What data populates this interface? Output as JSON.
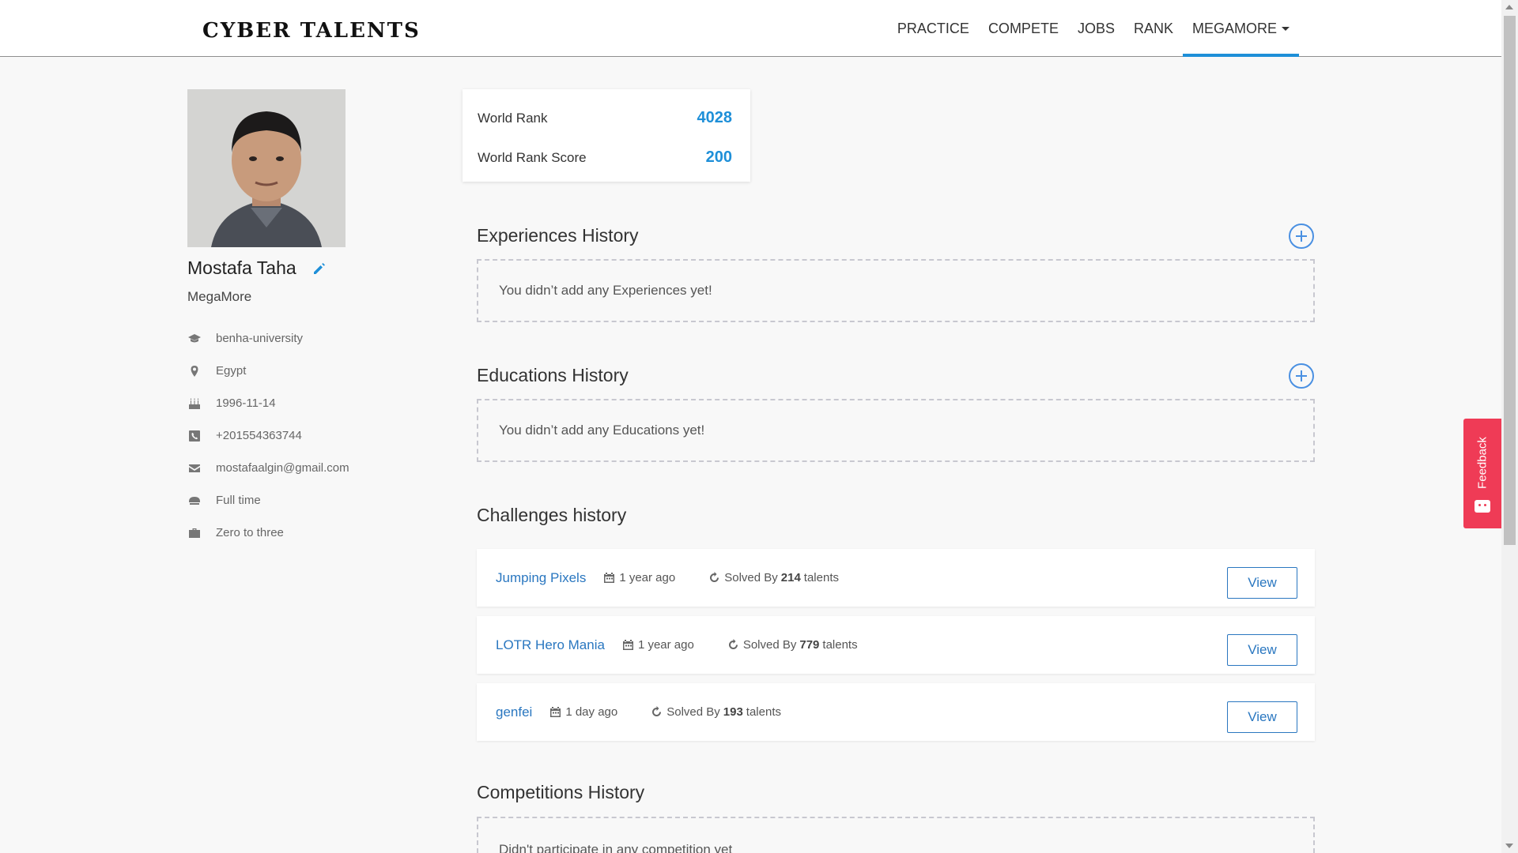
{
  "header": {
    "logo": "CYBER TALENTS",
    "nav": [
      {
        "label": "PRACTICE"
      },
      {
        "label": "COMPETE"
      },
      {
        "label": "JOBS"
      },
      {
        "label": "RANK"
      },
      {
        "label": "MEGAMORE"
      }
    ]
  },
  "profile": {
    "name": "Mostafa Taha",
    "company": "MegaMore",
    "info": [
      {
        "icon": "graduation-cap-icon",
        "text": "benha-university"
      },
      {
        "icon": "map-marker-icon",
        "text": "Egypt"
      },
      {
        "icon": "birthday-cake-icon",
        "text": "1996-11-14"
      },
      {
        "icon": "phone-icon",
        "text": "+201554363744"
      },
      {
        "icon": "envelope-icon",
        "text": "mostafaalgin@gmail.com"
      },
      {
        "icon": "job-type-icon",
        "text": "Full time"
      },
      {
        "icon": "briefcase-icon",
        "text": "Zero to three"
      }
    ]
  },
  "rank": {
    "world_rank_label": "World Rank",
    "world_rank_value": "4028",
    "score_label": "World Rank Score",
    "score_value": "200"
  },
  "experiences": {
    "title": "Experiences History",
    "empty": "You didn’t add any Experiences yet!"
  },
  "educations": {
    "title": "Educations History",
    "empty": "You didn’t add any Educations yet!"
  },
  "challenges": {
    "title": "Challenges history",
    "solved_by_label": "Solved By",
    "talents_label": "talents",
    "view_label": "View",
    "items": [
      {
        "name": "Jumping Pixels",
        "date": "1 year ago",
        "solved": "214"
      },
      {
        "name": "LOTR Hero Mania",
        "date": "1 year ago",
        "solved": "779"
      },
      {
        "name": "genfei",
        "date": "1 day ago",
        "solved": "193"
      }
    ]
  },
  "competitions": {
    "title": "Competitions History",
    "empty": "Didn't participate in any competition yet"
  },
  "feedback": {
    "label": "Feedback"
  },
  "colors": {
    "accent": "#1e8fd8",
    "link": "#2a77c0",
    "feedback": "#ef3b56"
  }
}
